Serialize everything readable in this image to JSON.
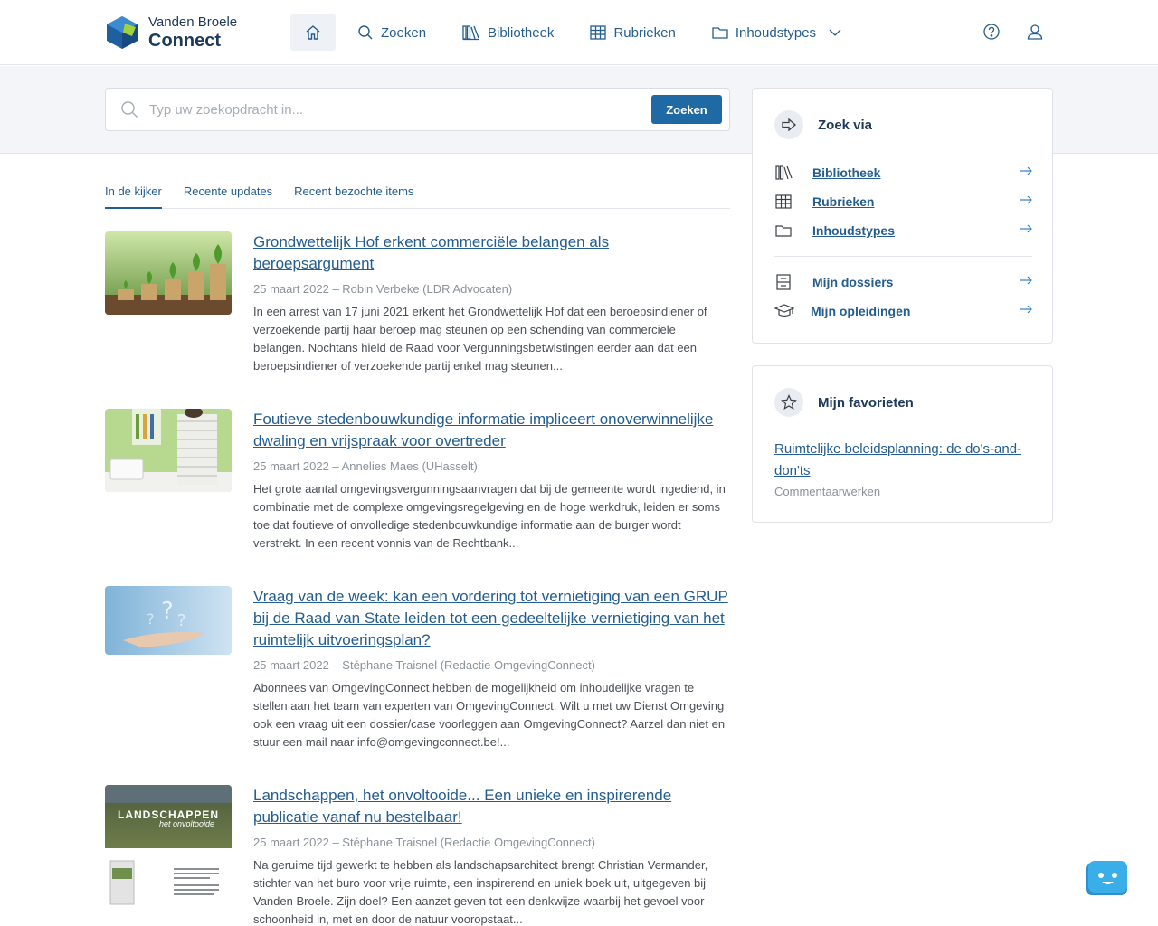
{
  "brand": {
    "line1": "Vanden Broele",
    "line2": "Connect"
  },
  "nav": {
    "items": [
      {
        "label": "Zoeken",
        "icon": "search-icon"
      },
      {
        "label": "Bibliotheek",
        "icon": "library-icon"
      },
      {
        "label": "Rubrieken",
        "icon": "grid-icon"
      },
      {
        "label": "Inhoudstypes",
        "icon": "folder-icon"
      }
    ]
  },
  "search": {
    "placeholder": "Typ uw zoekopdracht in...",
    "button": "Zoeken"
  },
  "tabs": [
    {
      "label": "In de kijker",
      "active": true
    },
    {
      "label": "Recente updates",
      "active": false
    },
    {
      "label": "Recent bezochte items",
      "active": false
    }
  ],
  "articles": [
    {
      "title": "Grondwettelijk Hof erkent commerciële belangen als beroepsargument",
      "meta": "25 maart 2022 – Robin Verbeke (LDR Advocaten)",
      "excerpt": "In een arrest van 17 juni 2021 erkent het Grondwettelijk Hof dat een beroepsindiener of verzoekende partij haar beroep mag steunen op een schending van commerciële belangen. Nochtans hield de Raad voor Vergunningsbetwistingen eerder aan dat een beroepsindiener of verzoekende partij enkel mag steunen..."
    },
    {
      "title": "Foutieve stedenbouwkundige informatie impliceert onoverwinnelijke dwaling en vrijspraak voor overtreder",
      "meta": "25 maart 2022 – Annelies Maes (UHasselt)",
      "excerpt": "Het grote aantal omgevingsvergunningsaanvragen dat bij de gemeente wordt ingediend, in combinatie met de complexe omgevingsregelgeving en de hoge werkdruk, leiden er soms toe dat foutieve of onvolledige stedenbouwkundige informatie aan de burger wordt verstrekt. In een recent vonnis van de Rechtbank..."
    },
    {
      "title": "Vraag van de week: kan een vordering tot vernietiging van een GRUP bij de Raad van State leiden tot een gedeeltelijke vernietiging van het ruimtelijk uitvoeringsplan?",
      "meta": "25 maart 2022 – Stéphane Traisnel (Redactie OmgevingConnect)",
      "excerpt": "Abonnees van OmgevingConnect hebben de mogelijkheid om inhoudelijke vragen te stellen aan het team van experten van OmgevingConnect. Wilt u met uw Dienst Omgeving ook een vraag uit een dossier/case voorleggen aan OmgevingConnect? Aarzel dan niet en stuur een mail naar info@omgevingconnect.be!..."
    },
    {
      "title": "Landschappen, het onvoltooide... Een unieke en inspirerende publicatie vanaf nu bestelbaar!",
      "meta": "25 maart 2022 – Stéphane Traisnel (Redactie OmgevingConnect)",
      "excerpt": "Na geruime tijd gewerkt te hebben als landschapsarchitect brengt Christian Vermander, stichter van het buro voor vrije ruimte, een inspirerend en uniek boek uit, uitgegeven bij Vanden Broele. Zijn doel? Een aanzet geven tot een denkwijze waarbij het gevoel voor schoonheid in, met en door de natuur vooropstaat...",
      "thumb_text": {
        "title": "LANDSCHAPPEN",
        "subtitle": "het onvoltooide"
      }
    }
  ],
  "zoek_via": {
    "title": "Zoek via",
    "links": [
      {
        "label": "Bibliotheek",
        "icon": "library-icon"
      },
      {
        "label": "Rubrieken",
        "icon": "grid-icon"
      },
      {
        "label": "Inhoudstypes",
        "icon": "folder-icon"
      }
    ],
    "links2": [
      {
        "label": "Mijn dossiers",
        "icon": "dossier-icon"
      },
      {
        "label": "Mijn opleidingen",
        "icon": "graduation-cap-icon"
      }
    ]
  },
  "favorites": {
    "title": "Mijn favorieten",
    "item": {
      "label": "Ruimtelijke beleidsplanning: de do's-and-don'ts",
      "sub": "Commentaarwerken"
    }
  },
  "colors": {
    "accent": "#1f6aa5",
    "link": "#245d8f",
    "band": "#f3f5f8",
    "chat": "#3aaee8"
  }
}
